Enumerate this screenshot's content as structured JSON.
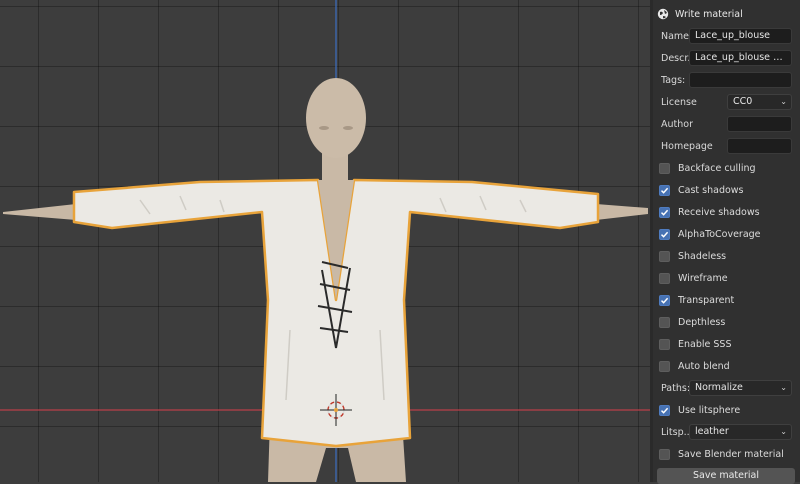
{
  "panel": {
    "title": "Write material",
    "title_icon": "globe-icon",
    "name_label": "Name:",
    "name_value": "Lace_up_blouse",
    "descr_label": "Descr...",
    "descr_value": "Lace_up_blouse mater...",
    "tags_label": "Tags:",
    "tags_value": "",
    "license_label": "License",
    "license_value": "CC0",
    "author_label": "Author",
    "author_value": "",
    "homepage_label": "Homepage",
    "homepage_value": "",
    "checkboxes": [
      {
        "label": "Backface culling",
        "checked": false
      },
      {
        "label": "Cast shadows",
        "checked": true
      },
      {
        "label": "Receive shadows",
        "checked": true
      },
      {
        "label": "AlphaToCoverage",
        "checked": true
      },
      {
        "label": "Shadeless",
        "checked": false
      },
      {
        "label": "Wireframe",
        "checked": false
      },
      {
        "label": "Transparent",
        "checked": true
      },
      {
        "label": "Depthless",
        "checked": false
      },
      {
        "label": "Enable SSS",
        "checked": false
      },
      {
        "label": "Auto blend",
        "checked": false
      }
    ],
    "paths_label": "Paths:",
    "paths_value": "Normalize",
    "use_litsphere_label": "Use litsphere",
    "use_litsphere_checked": true,
    "litsphere_label": "Litsp...",
    "litsphere_value": "leather",
    "save_blender_label": "Save Blender material",
    "save_blender_checked": false,
    "save_button": "Save material"
  },
  "colors": {
    "viewport_bg": "#3d3d3d",
    "panel_bg": "#303030",
    "checkbox_on": "#4772b3",
    "selection_outline": "#e8a33a",
    "x_axis": "#b8404a",
    "z_axis": "#3d6fc0"
  }
}
